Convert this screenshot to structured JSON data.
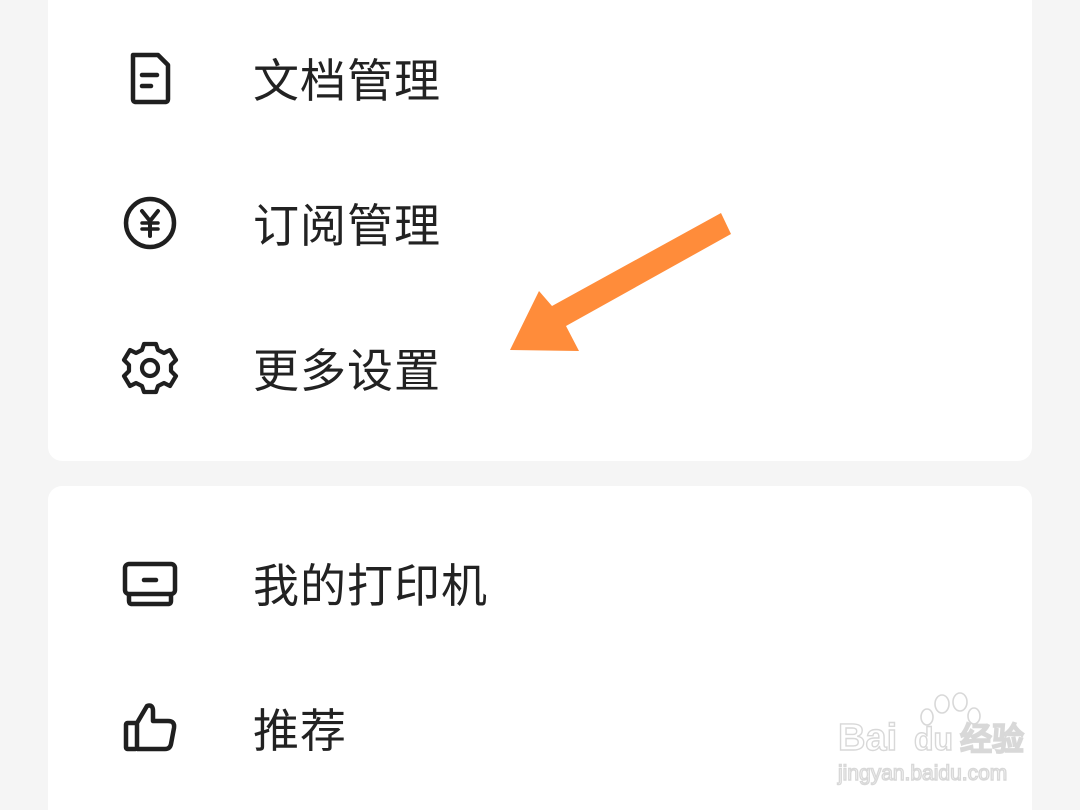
{
  "menu_top": {
    "items": [
      {
        "label": "文档管理",
        "icon": "document-icon"
      },
      {
        "label": "订阅管理",
        "icon": "yen-coin-icon"
      },
      {
        "label": "更多设置",
        "icon": "gear-icon"
      }
    ]
  },
  "menu_bottom": {
    "items": [
      {
        "label": "我的打印机",
        "icon": "printer-icon"
      },
      {
        "label": "推荐",
        "icon": "thumbs-up-icon"
      }
    ]
  },
  "annotation": {
    "arrow_color": "#ff8c3a"
  },
  "watermark": {
    "brand_latin": "Bai",
    "brand_du": "du",
    "brand_cn": "经验",
    "url": "jingyan.baidu.com"
  },
  "colors": {
    "background": "#f5f5f5",
    "card": "#ffffff",
    "text": "#222222",
    "icon": "#1f1f1f"
  }
}
